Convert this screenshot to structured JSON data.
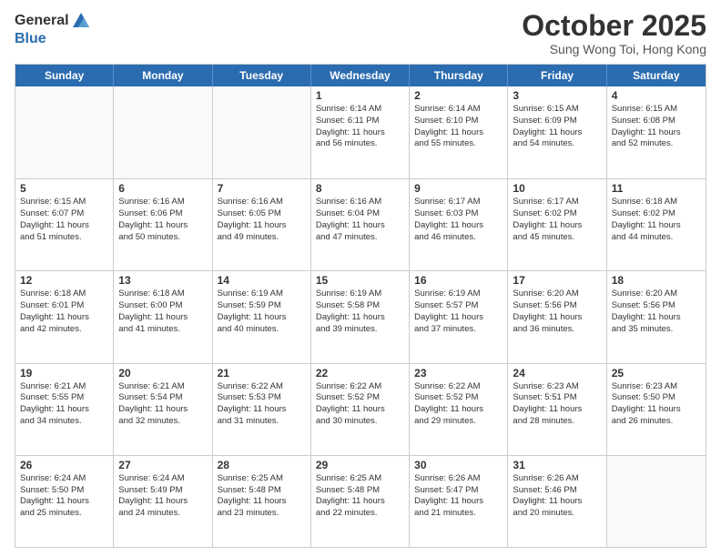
{
  "logo": {
    "general": "General",
    "blue": "Blue"
  },
  "header": {
    "month": "October 2025",
    "location": "Sung Wong Toi, Hong Kong"
  },
  "days": [
    "Sunday",
    "Monday",
    "Tuesday",
    "Wednesday",
    "Thursday",
    "Friday",
    "Saturday"
  ],
  "weeks": [
    [
      {
        "day": "",
        "info": ""
      },
      {
        "day": "",
        "info": ""
      },
      {
        "day": "",
        "info": ""
      },
      {
        "day": "1",
        "info": "Sunrise: 6:14 AM\nSunset: 6:11 PM\nDaylight: 11 hours\nand 56 minutes."
      },
      {
        "day": "2",
        "info": "Sunrise: 6:14 AM\nSunset: 6:10 PM\nDaylight: 11 hours\nand 55 minutes."
      },
      {
        "day": "3",
        "info": "Sunrise: 6:15 AM\nSunset: 6:09 PM\nDaylight: 11 hours\nand 54 minutes."
      },
      {
        "day": "4",
        "info": "Sunrise: 6:15 AM\nSunset: 6:08 PM\nDaylight: 11 hours\nand 52 minutes."
      }
    ],
    [
      {
        "day": "5",
        "info": "Sunrise: 6:15 AM\nSunset: 6:07 PM\nDaylight: 11 hours\nand 51 minutes."
      },
      {
        "day": "6",
        "info": "Sunrise: 6:16 AM\nSunset: 6:06 PM\nDaylight: 11 hours\nand 50 minutes."
      },
      {
        "day": "7",
        "info": "Sunrise: 6:16 AM\nSunset: 6:05 PM\nDaylight: 11 hours\nand 49 minutes."
      },
      {
        "day": "8",
        "info": "Sunrise: 6:16 AM\nSunset: 6:04 PM\nDaylight: 11 hours\nand 47 minutes."
      },
      {
        "day": "9",
        "info": "Sunrise: 6:17 AM\nSunset: 6:03 PM\nDaylight: 11 hours\nand 46 minutes."
      },
      {
        "day": "10",
        "info": "Sunrise: 6:17 AM\nSunset: 6:02 PM\nDaylight: 11 hours\nand 45 minutes."
      },
      {
        "day": "11",
        "info": "Sunrise: 6:18 AM\nSunset: 6:02 PM\nDaylight: 11 hours\nand 44 minutes."
      }
    ],
    [
      {
        "day": "12",
        "info": "Sunrise: 6:18 AM\nSunset: 6:01 PM\nDaylight: 11 hours\nand 42 minutes."
      },
      {
        "day": "13",
        "info": "Sunrise: 6:18 AM\nSunset: 6:00 PM\nDaylight: 11 hours\nand 41 minutes."
      },
      {
        "day": "14",
        "info": "Sunrise: 6:19 AM\nSunset: 5:59 PM\nDaylight: 11 hours\nand 40 minutes."
      },
      {
        "day": "15",
        "info": "Sunrise: 6:19 AM\nSunset: 5:58 PM\nDaylight: 11 hours\nand 39 minutes."
      },
      {
        "day": "16",
        "info": "Sunrise: 6:19 AM\nSunset: 5:57 PM\nDaylight: 11 hours\nand 37 minutes."
      },
      {
        "day": "17",
        "info": "Sunrise: 6:20 AM\nSunset: 5:56 PM\nDaylight: 11 hours\nand 36 minutes."
      },
      {
        "day": "18",
        "info": "Sunrise: 6:20 AM\nSunset: 5:56 PM\nDaylight: 11 hours\nand 35 minutes."
      }
    ],
    [
      {
        "day": "19",
        "info": "Sunrise: 6:21 AM\nSunset: 5:55 PM\nDaylight: 11 hours\nand 34 minutes."
      },
      {
        "day": "20",
        "info": "Sunrise: 6:21 AM\nSunset: 5:54 PM\nDaylight: 11 hours\nand 32 minutes."
      },
      {
        "day": "21",
        "info": "Sunrise: 6:22 AM\nSunset: 5:53 PM\nDaylight: 11 hours\nand 31 minutes."
      },
      {
        "day": "22",
        "info": "Sunrise: 6:22 AM\nSunset: 5:52 PM\nDaylight: 11 hours\nand 30 minutes."
      },
      {
        "day": "23",
        "info": "Sunrise: 6:22 AM\nSunset: 5:52 PM\nDaylight: 11 hours\nand 29 minutes."
      },
      {
        "day": "24",
        "info": "Sunrise: 6:23 AM\nSunset: 5:51 PM\nDaylight: 11 hours\nand 28 minutes."
      },
      {
        "day": "25",
        "info": "Sunrise: 6:23 AM\nSunset: 5:50 PM\nDaylight: 11 hours\nand 26 minutes."
      }
    ],
    [
      {
        "day": "26",
        "info": "Sunrise: 6:24 AM\nSunset: 5:50 PM\nDaylight: 11 hours\nand 25 minutes."
      },
      {
        "day": "27",
        "info": "Sunrise: 6:24 AM\nSunset: 5:49 PM\nDaylight: 11 hours\nand 24 minutes."
      },
      {
        "day": "28",
        "info": "Sunrise: 6:25 AM\nSunset: 5:48 PM\nDaylight: 11 hours\nand 23 minutes."
      },
      {
        "day": "29",
        "info": "Sunrise: 6:25 AM\nSunset: 5:48 PM\nDaylight: 11 hours\nand 22 minutes."
      },
      {
        "day": "30",
        "info": "Sunrise: 6:26 AM\nSunset: 5:47 PM\nDaylight: 11 hours\nand 21 minutes."
      },
      {
        "day": "31",
        "info": "Sunrise: 6:26 AM\nSunset: 5:46 PM\nDaylight: 11 hours\nand 20 minutes."
      },
      {
        "day": "",
        "info": ""
      }
    ]
  ]
}
